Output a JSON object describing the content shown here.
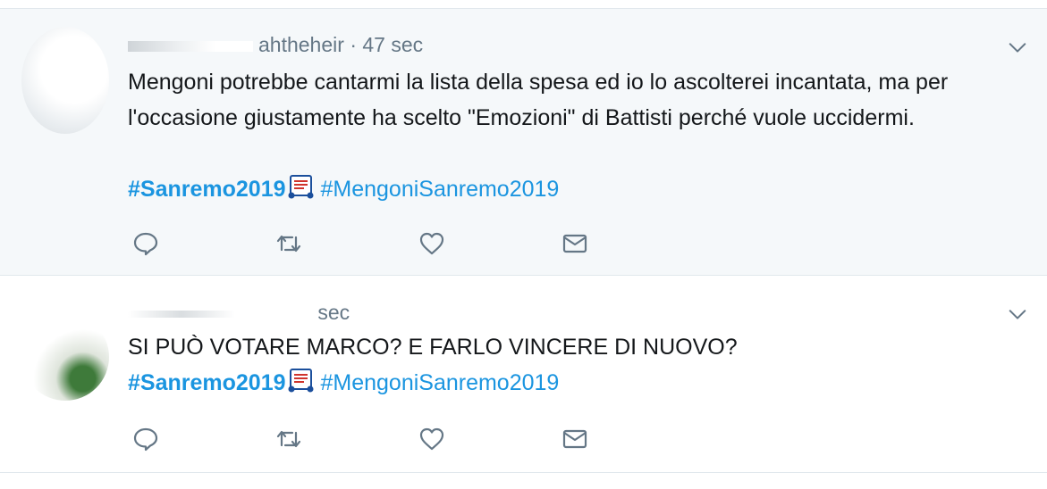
{
  "tweets": [
    {
      "handle_partial": "ahtheheir",
      "time": "· 47 sec",
      "text": "Mengoni potrebbe cantarmi la lista della spesa ed io lo ascolterei incantata, ma per l'occasione giustamente ha scelto \"Emozioni\" di Battisti perché vuole uccidermi.",
      "hashtag1": "#Sanremo2019",
      "hashtag2": "#MengoniSanremo2019"
    },
    {
      "handle_partial": "",
      "time": "sec",
      "text": "SI PUÒ VOTARE MARCO? E FARLO VINCERE DI NUOVO?",
      "hashtag1": "#Sanremo2019",
      "hashtag2": "#MengoniSanremo2019"
    }
  ],
  "icons": {
    "reply": "reply-icon",
    "retweet": "retweet-icon",
    "like": "heart-icon",
    "dm": "envelope-icon",
    "more": "chevron-down-icon",
    "hashflag": "music-score-emoji"
  },
  "colors": {
    "link": "#1b95e0",
    "muted": "#657786",
    "text": "#14171a",
    "highlight_bg": "#f5f8fa",
    "border": "#e1e8ed"
  }
}
